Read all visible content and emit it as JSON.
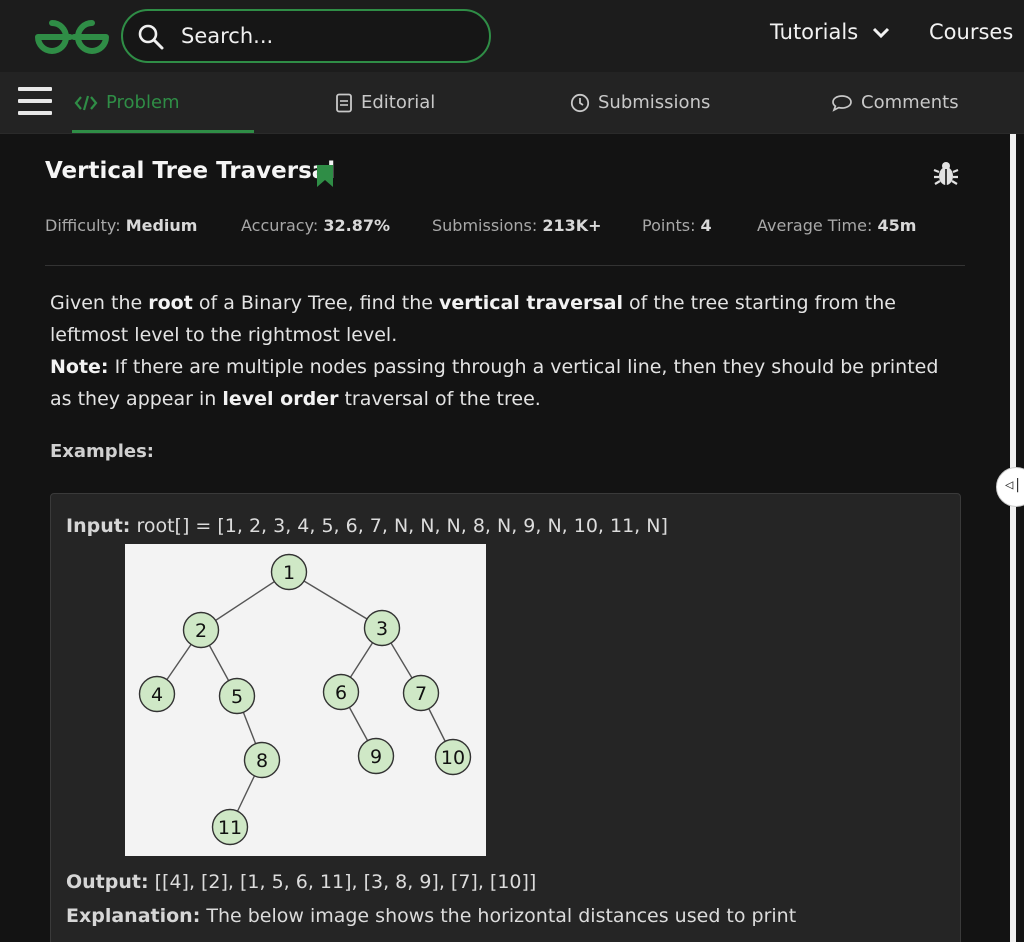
{
  "header": {
    "search_placeholder": "Search...",
    "nav": {
      "tutorials": "Tutorials",
      "courses": "Courses"
    }
  },
  "tabs": {
    "problem": "Problem",
    "editorial": "Editorial",
    "submissions": "Submissions",
    "comments": "Comments"
  },
  "problem": {
    "title": "Vertical Tree Traversal",
    "meta": {
      "difficulty_label": "Difficulty:",
      "difficulty": "Medium",
      "accuracy_label": "Accuracy:",
      "accuracy": "32.87%",
      "submissions_label": "Submissions:",
      "submissions": "213K+",
      "points_label": "Points:",
      "points": "4",
      "avg_time_label": "Average Time:",
      "avg_time": "45m"
    },
    "description": {
      "p1_a": "Given the ",
      "p1_b": "root",
      "p1_c": " of a Binary Tree, find the ",
      "p1_d": "vertical traversal",
      "p1_e": " of the tree starting from the leftmost level to the rightmost level.",
      "p2_label": "Note:",
      "p2_a": " If there are multiple nodes passing through a vertical line, then they should be printed as they appear in ",
      "p2_b": "level order",
      "p2_c": " traversal of the tree."
    },
    "examples_heading": "Examples:",
    "example1": {
      "input_label": "Input:",
      "input_value": " root[] = [1, 2, 3, 4, 5, 6, 7, N, N, N, 8, N, 9, N, 10, 11, N]",
      "output_label": "Output:",
      "output_value": " [[4], [2], [1, 5, 6, 11], [3, 8, 9], [7], [10]]",
      "explanation_label": "Explanation:",
      "explanation_value": " The below image shows the horizontal distances used to print"
    },
    "tree_nodes": {
      "n1": "1",
      "n2": "2",
      "n3": "3",
      "n4": "4",
      "n5": "5",
      "n6": "6",
      "n7": "7",
      "n8": "8",
      "n9": "9",
      "n10": "10",
      "n11": "11"
    }
  },
  "colors": {
    "accent": "#2f8d46",
    "background": "#131313",
    "panel": "#252525"
  },
  "icons": [
    "gfg-logo",
    "search-icon",
    "chevron-down-icon",
    "hamburger-icon",
    "code-icon",
    "document-icon",
    "clock-icon",
    "comment-icon",
    "bookmark-icon",
    "bug-icon",
    "collapse-handle-icon"
  ]
}
